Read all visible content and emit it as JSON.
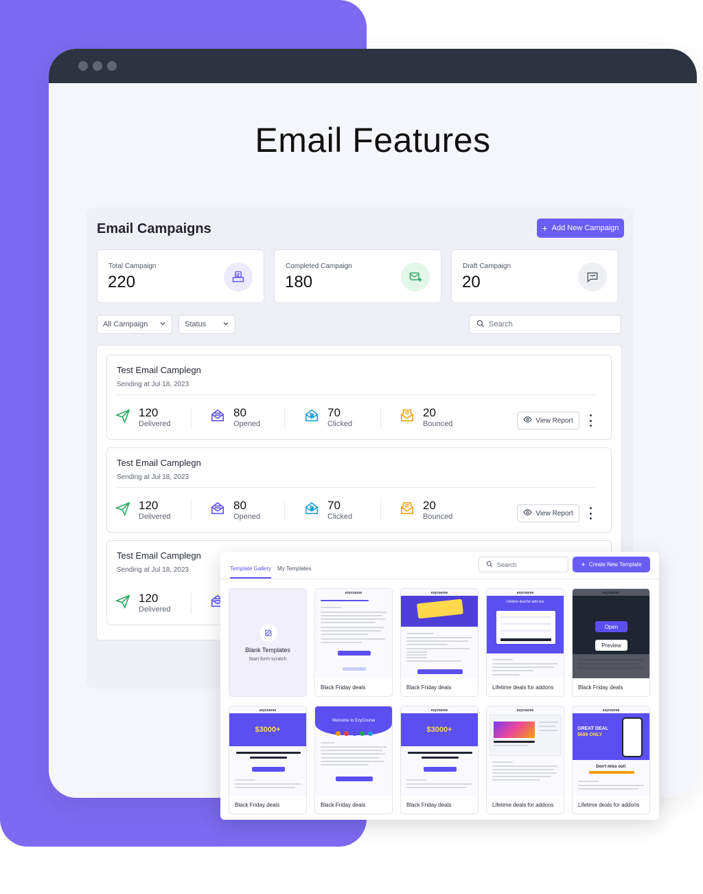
{
  "page": {
    "title": "Email Features"
  },
  "campaigns": {
    "title": "Email Campaigns",
    "add_button": "Add New Campaign",
    "stats": [
      {
        "label": "Total Campaign",
        "value": "220",
        "icon": "campaign-stack-icon"
      },
      {
        "label": "Completed Campaign",
        "value": "180",
        "icon": "mail-sent-icon"
      },
      {
        "label": "Draft Campaign",
        "value": "20",
        "icon": "draft-message-icon"
      }
    ],
    "filter_all": "All Campaign",
    "filter_status": "Status",
    "search_placeholder": "Search",
    "items": [
      {
        "name": "Test Email Camplegn",
        "date": "Sending at Jul 18, 2023",
        "delivered": "120",
        "delivered_label": "Delivered",
        "opened": "80",
        "opened_label": "Opened",
        "clicked": "70",
        "clicked_label": "Clicked",
        "bounced": "20",
        "bounced_label": "Bounced",
        "view_label": "View Report"
      },
      {
        "name": "Test Email Camplegn",
        "date": "Sending at Jul 18, 2023",
        "delivered": "120",
        "delivered_label": "Delivered",
        "opened": "80",
        "opened_label": "Opened",
        "clicked": "70",
        "clicked_label": "Clicked",
        "bounced": "20",
        "bounced_label": "Bounced",
        "view_label": "View Report"
      },
      {
        "name": "Test Email Camplegn",
        "date": "Sending at Jul 18, 2023",
        "delivered": "120",
        "delivered_label": "Delivered"
      }
    ]
  },
  "gallery": {
    "tabs": [
      "Template Gallery",
      "My Templates"
    ],
    "search_placeholder": "Search",
    "create_button": "Create New Template",
    "blank": {
      "title": "Blank Templates",
      "subtitle": "Start form scratch"
    },
    "overlay_open": "Open",
    "overlay_preview": "Preview",
    "brand": "ezycourse",
    "templates": [
      {
        "caption": "Black Friday deals"
      },
      {
        "caption": "Black Friday deals"
      },
      {
        "caption": "Lifetime deals for addons"
      },
      {
        "caption": "Black Friday deals"
      },
      {
        "caption": "Black Friday deals"
      },
      {
        "caption": "Black Friday deals"
      },
      {
        "caption": "Black Friday deals"
      },
      {
        "caption": "Lifetime deals for addons"
      },
      {
        "caption": "Lifetime deals for addons"
      }
    ],
    "thumb_texts": {
      "price": "$3000+",
      "welcome": "Welcome to EzyCourse",
      "great_deal": "GREAT DEAL",
      "deal_price": "$699 ONLY",
      "lifetime": "Lifetime deal for add-ons",
      "dont_miss": "Don't miss out!"
    }
  },
  "colors": {
    "accent": "#6a5df5",
    "purple_bg": "#7c6af0",
    "delivered": "#22a55a",
    "opened": "#5b4ff0",
    "clicked": "#1e9ad6",
    "bounced": "#f59e0b"
  }
}
